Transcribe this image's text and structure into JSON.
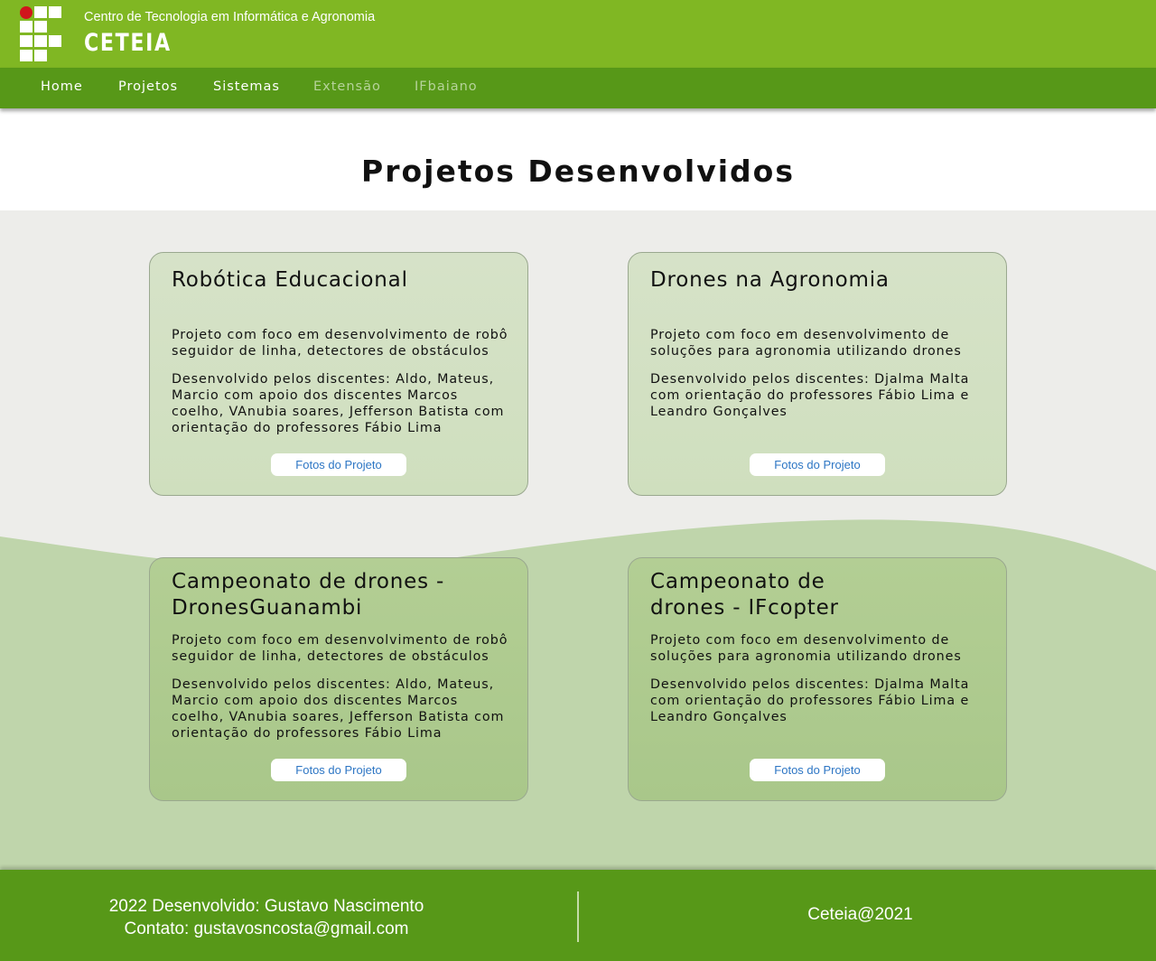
{
  "header": {
    "org_name": "Centro de Tecnologia em Informática e Agronomia",
    "brand": "CETEIA"
  },
  "nav": {
    "items": [
      {
        "label": "Home"
      },
      {
        "label": "Projetos"
      },
      {
        "label": "Sistemas"
      },
      {
        "label": "Extensão"
      },
      {
        "label": "IFbaiano"
      }
    ]
  },
  "main": {
    "title": "Projetos Desenvolvidos",
    "cards": [
      {
        "title": "Robótica Educacional",
        "description": "Projeto com foco em desenvolvimento de robô seguidor de linha, detectores de obstáculos",
        "credits": "Desenvolvido pelos discentes: Aldo, Mateus, Marcio com apoio dos discentes Marcos coelho, VAnubia soares, Jefferson Batista com orientação do professores Fábio Lima",
        "button": "Fotos do Projeto"
      },
      {
        "title": "Drones na Agronomia",
        "description": "Projeto com foco em desenvolvimento de soluções para agronomia utilizando drones",
        "credits": "Desenvolvido pelos discentes: Djalma Malta com orientação do professores Fábio Lima e Leandro Gonçalves",
        "button": "Fotos do Projeto"
      },
      {
        "title": "Campeonato de drones - DronesGuanambi",
        "description": "Projeto com foco em desenvolvimento de robô seguidor de linha, detectores de obstáculos",
        "credits": "Desenvolvido pelos discentes: Aldo, Mateus, Marcio com apoio dos discentes Marcos coelho, VAnubia soares, Jefferson Batista com orientação do professores Fábio Lima",
        "button": "Fotos do Projeto"
      },
      {
        "title": "Campeonato de drones - IFcopter",
        "description": "Projeto com foco em desenvolvimento de soluções para agronomia utilizando drones",
        "credits": "Desenvolvido pelos discentes: Djalma Malta com orientação do professores Fábio Lima e Leandro Gonçalves",
        "button": "Fotos do Projeto"
      }
    ]
  },
  "footer": {
    "developer": "2022 Desenvolvido: Gustavo Nascimento",
    "contact": "Contato: gustavosncosta@gmail.com",
    "copyright": "Ceteia@2021"
  },
  "colors": {
    "header_green": "#80b723",
    "nav_green": "#579818",
    "accent_red": "#d0151c",
    "link_blue": "#2d76c4"
  }
}
